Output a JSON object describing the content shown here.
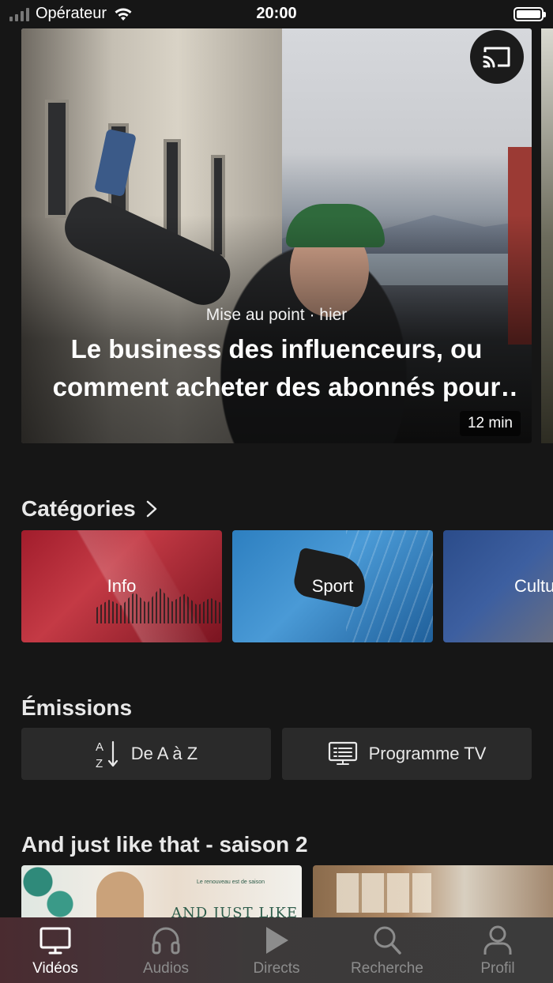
{
  "status_bar": {
    "carrier": "Opérateur",
    "time": "20:00"
  },
  "hero": {
    "meta": "Mise au point · hier",
    "title": "Le business des influenceurs, ou comment acheter des abonnés pour booster sa notoriété",
    "duration": "12 min"
  },
  "categories": {
    "title": "Catégories",
    "items": [
      {
        "label": "Info",
        "color": "#a11d2c"
      },
      {
        "label": "Sport",
        "color": "#2d7fc0"
      },
      {
        "label": "Cultu",
        "color": "#2b4c8a"
      }
    ]
  },
  "emissions": {
    "title": "Émissions",
    "az_label": "De A à Z",
    "program_label": "Programme TV"
  },
  "show": {
    "title": "And just like that - saison 2",
    "thumb_small": "Le renouveau est de saison",
    "thumb_text": "AND JUST LIKE THAT"
  },
  "tabbar": {
    "items": [
      {
        "label": "Vidéos",
        "icon": "tv-icon",
        "active": true
      },
      {
        "label": "Audios",
        "icon": "headphones-icon",
        "active": false
      },
      {
        "label": "Directs",
        "icon": "play-icon",
        "active": false
      },
      {
        "label": "Recherche",
        "icon": "search-icon",
        "active": false
      },
      {
        "label": "Profil",
        "icon": "person-icon",
        "active": false
      }
    ]
  }
}
